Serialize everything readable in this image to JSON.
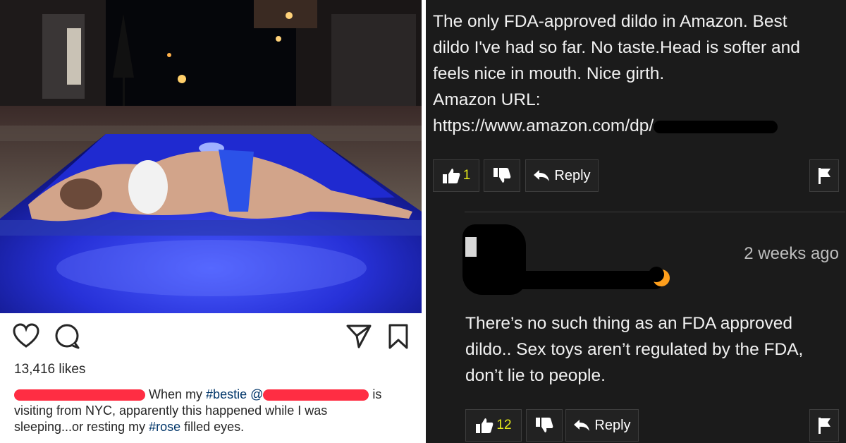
{
  "instagram": {
    "likes": "13,416 likes",
    "caption": {
      "text_a": "When my ",
      "tag1": "#bestie",
      "mention": "@",
      "text_b": "is",
      "line2": "visiting from  NYC, apparently this happened while I was",
      "line3_a": "sleeping...or resting my ",
      "tag2": "#rose",
      "line3_b": " filled eyes."
    },
    "icons": [
      "heart-icon",
      "comment-icon",
      "share-icon",
      "bookmark-icon"
    ]
  },
  "comment": {
    "line1": "The only FDA-approved dildo in Amazon. Best",
    "line2": "dildo I've had so far. No taste.Head is softer and",
    "line3": "feels nice in mouth. Nice girth.",
    "line4": "Amazon URL:",
    "line5": "https://www.amazon.com/dp/",
    "like_count": "1",
    "reply_label": "Reply"
  },
  "reply": {
    "time": "2 weeks ago",
    "line1": "There’s no such thing as an FDA approved",
    "line2": "dildo.. Sex toys aren’t regulated by the FDA,",
    "line3": "don’t lie to people.",
    "like_count": "12",
    "reply_label": "Reply"
  },
  "colors": {
    "panel_bg": "#1b1b1b",
    "like_count": "#e4e81b",
    "hashtag": "#003569",
    "redaction_red": "#ff2d43",
    "avatar_badge": "#ff9f1c"
  }
}
